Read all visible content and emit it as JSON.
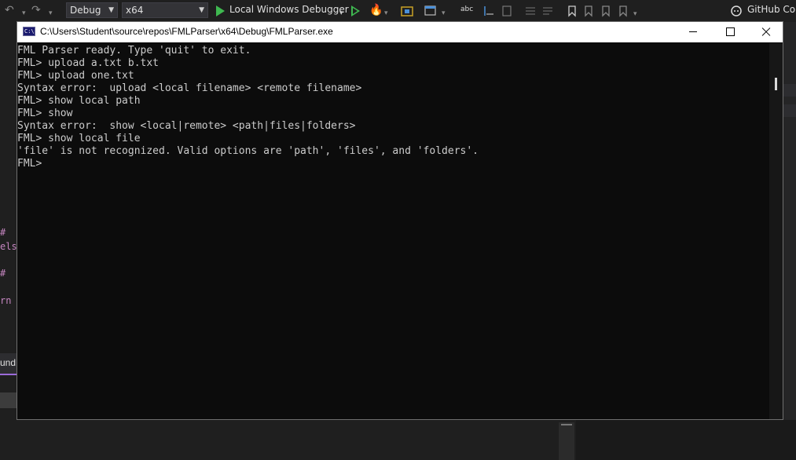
{
  "toolbar": {
    "configuration": "Debug",
    "platform": "x64",
    "debugger_label": "Local Windows Debugger",
    "copilot_label": "GitHub Cop"
  },
  "background_editor": {
    "fragments": [
      "#",
      "else",
      "#",
      "rn (",
      "und"
    ]
  },
  "console": {
    "title": "C:\\Users\\Student\\source\\repos\\FMLParser\\x64\\Debug\\FMLParser.exe",
    "icon_text": "C:\\",
    "lines": [
      "FML Parser ready. Type 'quit' to exit.",
      "FML> upload a.txt b.txt",
      "FML> upload one.txt",
      "Syntax error:  upload <local filename> <remote filename>",
      "FML> show local path",
      "FML> show",
      "Syntax error:  show <local|remote> <path|files|folders>",
      "FML> show local file",
      "'file' is not recognized. Valid options are 'path', 'files', and 'folders'.",
      "FML>"
    ]
  },
  "colors": {
    "console_bg": "#0c0c0c",
    "console_text": "#cccccc",
    "run_green": "#3fb950",
    "vs_bg": "#1f1f1f"
  }
}
